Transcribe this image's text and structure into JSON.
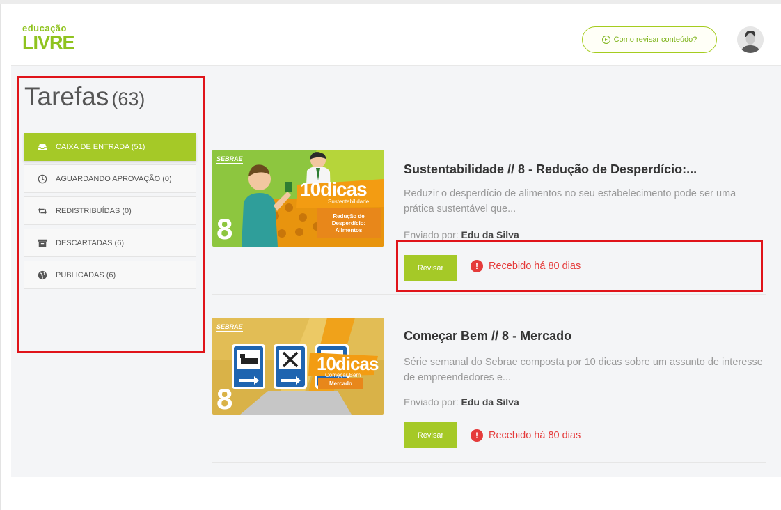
{
  "logo": {
    "line1": "educação",
    "line2": "LIVRE"
  },
  "header": {
    "howto_label": "Como revisar conteúdo?"
  },
  "page": {
    "title": "Tarefas",
    "count": "(63)"
  },
  "sidebar": {
    "items": [
      {
        "label": "CAIXA DE ENTRADA (51)",
        "icon": "inbox-icon",
        "active": true
      },
      {
        "label": "AGUARDANDO APROVAÇÃO (0)",
        "icon": "clock-icon"
      },
      {
        "label": "REDISTRIBUÍDAS (0)",
        "icon": "retweet-icon"
      },
      {
        "label": "DESCARTADAS (6)",
        "icon": "archive-icon"
      },
      {
        "label": "PUBLICADAS (6)",
        "icon": "globe-icon"
      }
    ]
  },
  "tasks": [
    {
      "title": "Sustentabilidade // 8 - Redução de Desperdício:...",
      "description": "Reduzir o desperdício de alimentos no seu estabelecimento pode ser uma prática sustentável que...",
      "sender_label": "Enviado por:",
      "sender_name": "Edu da Silva",
      "review_label": "Revisar",
      "received": "Recebido há 80 dias",
      "thumb": {
        "brand": "SEBRAE",
        "number": "8",
        "tips": "10dicas",
        "topic": "Sustentabilidade",
        "subtitle": "Redução de Desperdício: Alimentos"
      }
    },
    {
      "title": "Começar Bem // 8 - Mercado",
      "description": "Série semanal do Sebrae composta por 10 dicas sobre um assunto de interesse de empreendedores e...",
      "sender_label": "Enviado por:",
      "sender_name": "Edu da Silva",
      "review_label": "Revisar",
      "received": "Recebido há 80 dias",
      "thumb": {
        "brand": "SEBRAE",
        "number": "8",
        "tips": "10dicas",
        "topic": "Começar Bem",
        "subtitle": "Mercado"
      }
    }
  ],
  "colors": {
    "accent": "#a5c927",
    "alert": "#e53b3b",
    "highlight_box": "#e0141a"
  }
}
